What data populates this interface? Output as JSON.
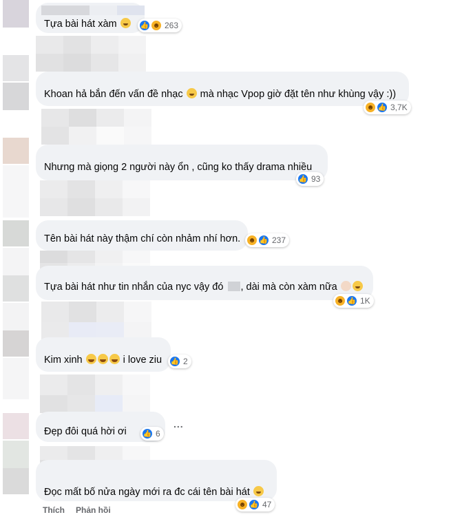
{
  "comments": [
    {
      "text": "Tựa bài hát xàm ",
      "reaction_count": "263",
      "reactions": [
        "like-icon",
        "haha-icon"
      ]
    },
    {
      "text": "Khoan hả bắn đến vấn đề nhạc ",
      "text_after": " mà nhạc Vpop giờ đặt tên như khùng vậy :))",
      "reaction_count": "3,7K",
      "reactions": [
        "haha-icon",
        "like-icon"
      ]
    },
    {
      "text": "Nhưng mà giọng 2 người này ổn , cũng ko thấy drama nhiều",
      "reaction_count": "93",
      "reactions": [
        "like-icon"
      ]
    },
    {
      "text": "Tên bài hát này thậm chí còn nhảm nhí hơn.",
      "reaction_count": "237",
      "reactions": [
        "haha-icon",
        "like-icon"
      ]
    },
    {
      "text": "Tựa bài hát như tin nhắn của nyc vậy đó ",
      "text_after": ", dài mà còn xàm nữa ",
      "reaction_count": "1K",
      "reactions": [
        "haha-icon",
        "like-icon"
      ]
    },
    {
      "text": "Kim xinh ",
      "text_after": " i love ziu",
      "reaction_count": "2",
      "reactions": [
        "like-icon"
      ]
    },
    {
      "text": "Đẹp đôi quá hời ơi",
      "reaction_count": "6",
      "reactions": [
        "like-icon"
      ]
    },
    {
      "text": "Đọc mất bố nửa ngày mới ra đc cái tên bài hát ",
      "reaction_count": "47",
      "reactions": [
        "haha-icon",
        "like-icon"
      ]
    }
  ],
  "actions": {
    "like": "Thích",
    "reply": "Phản hồi"
  },
  "more": "...",
  "colors": {
    "bubble": "#f0f2f5",
    "like": "#1877f2",
    "haha": "#f7b125",
    "meta": "#65676b"
  }
}
